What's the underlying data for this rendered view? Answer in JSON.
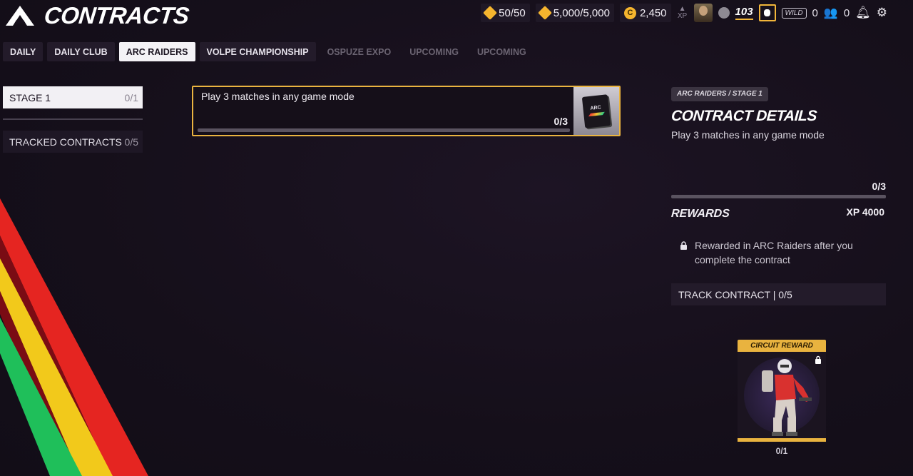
{
  "header": {
    "title": "CONTRACTS",
    "currencies": [
      {
        "icon": "diamond-icon",
        "value": "50/50"
      },
      {
        "icon": "crystal-icon",
        "value": "5,000/5,000"
      },
      {
        "icon": "coin-icon",
        "glyph": "C",
        "value": "2,450"
      }
    ],
    "xp_label": "XP",
    "level": "103",
    "wild_label": "WILD",
    "wild_count": "0",
    "friends_count": "0",
    "accent_color": "#eab440"
  },
  "tabs": [
    {
      "label": "DAILY"
    },
    {
      "label": "DAILY CLUB"
    },
    {
      "label": "ARC RAIDERS",
      "active": true
    },
    {
      "label": "VOLPE CHAMPIONSHIP"
    },
    {
      "label": "OSPUZE EXPO"
    },
    {
      "label": "UPCOMING"
    },
    {
      "label": "UPCOMING"
    }
  ],
  "sidebar": {
    "stage": {
      "label": "STAGE 1",
      "count": "0/1"
    },
    "tracked": {
      "label": "TRACKED CONTRACTS",
      "count": "0/5"
    }
  },
  "contract": {
    "text": "Play 3 matches in any game mode",
    "progress": "0/3",
    "progress_fraction": 0
  },
  "details": {
    "breadcrumb": "ARC RAIDERS / STAGE 1",
    "title": "CONTRACT DETAILS",
    "description": "Play 3 matches in any game mode",
    "progress": "0/3",
    "rewards_label": "REWARDS",
    "xp_reward": "XP 4000",
    "note": "Rewarded in ARC Raiders after you complete the contract",
    "track_button": "TRACK CONTRACT | 0/5"
  },
  "reward_card": {
    "header": "CIRCUIT REWARD",
    "count": "0/1"
  }
}
